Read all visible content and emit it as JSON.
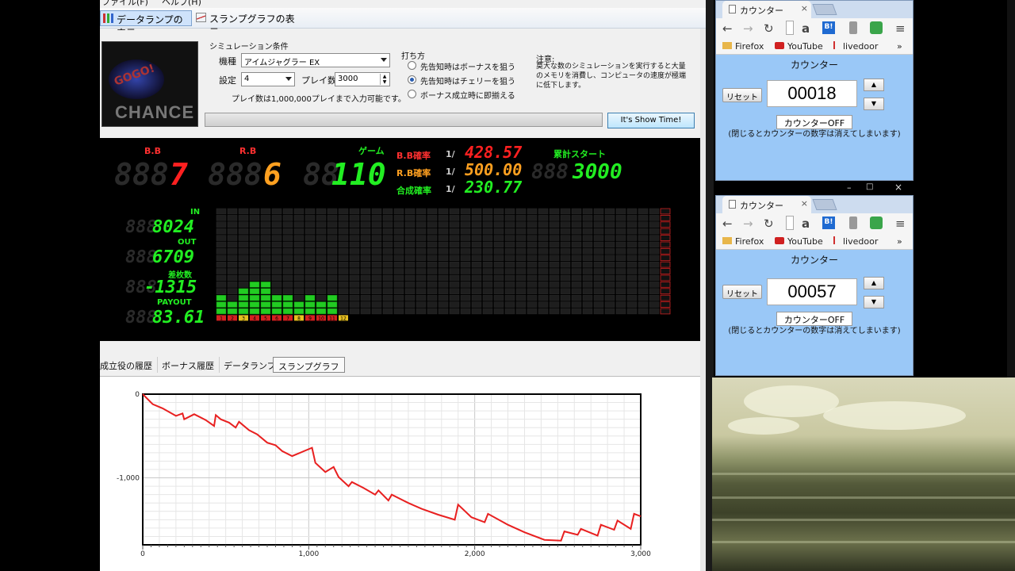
{
  "menu": {
    "file": "ファイル(F)",
    "help": "ヘルプ(H)"
  },
  "toolbar": {
    "data_lamp": "データランプの表示",
    "slump_graph": "スランプグラフの表示"
  },
  "logo": {
    "text1": "GOGO!",
    "text2": "CHANCE"
  },
  "sim": {
    "title": "シミュレーション条件",
    "model_label": "機種",
    "model_value": "アイムジャグラー EX",
    "setting_label": "設定",
    "setting_value": "4",
    "plays_label": "プレイ数",
    "plays_value": "3000",
    "plays_note": "プレイ数は1,000,000プレイまで入力可能です。"
  },
  "strategy": {
    "title": "打ち方",
    "options": [
      "先告知時はボーナスを狙う",
      "先告知時はチェリーを狙う",
      "ボーナス成立時に即揃える"
    ],
    "selected": 1
  },
  "caution": {
    "title": "注意:",
    "text": "莫大な数のシミュレーションを実行すると大量のメモリを消費し、コンピュータの速度が極端に低下します。"
  },
  "run_button": "It's Show Time!",
  "display": {
    "bb_label": "B.B",
    "bb_ghost": "888",
    "bb_value": "7",
    "rb_label": "R.B",
    "rb_ghost": "888",
    "rb_value": "6",
    "game_label": "ゲーム",
    "game_ghost": "88",
    "game_value": "110",
    "bb_rate_label": "B.B確率",
    "bb_rate_prefix": "1/",
    "bb_rate_value": "428.57",
    "rb_rate_label": "R.B確率",
    "rb_rate_prefix": "1/",
    "rb_rate_value": "500.00",
    "total_rate_label": "合成確率",
    "total_rate_prefix": "1/",
    "total_rate_value": "230.77",
    "total_start_label": "累計スタート",
    "total_start_ghost": "888",
    "total_start_value": "3000",
    "in_label": "IN",
    "in_ghost": "888",
    "in_value": "8024",
    "out_label": "OUT",
    "out_ghost": "888",
    "out_value": "6709",
    "diff_label": "差枚数",
    "diff_ghost": "888",
    "diff_value": "-1315",
    "payout_label": "PAYOUT",
    "payout_ghost": "888",
    "payout_value": "83.61",
    "lamp_levels": [
      3,
      2,
      4,
      5,
      5,
      3,
      3,
      2,
      3,
      2,
      3
    ],
    "lamp_labels": [
      "1",
      "2",
      "3",
      "4",
      "5",
      "6",
      "7",
      "8",
      "9",
      "10",
      "11",
      "12"
    ]
  },
  "tabs": [
    "成立役の履歴",
    "ボーナス履歴",
    "データランプ",
    "スランプグラフ"
  ],
  "active_tab": 3,
  "chart_data": {
    "type": "line",
    "title": "",
    "xlabel": "",
    "ylabel": "",
    "xlim": [
      0,
      3000
    ],
    "ylim": [
      -1800,
      0
    ],
    "x_ticks": [
      "0",
      "1,000",
      "2,000",
      "3,000"
    ],
    "y_ticks": [
      "0",
      "-1,000"
    ],
    "series": [
      {
        "x": [
          0,
          60,
          120,
          200,
          240,
          250,
          310,
          380,
          430,
          440,
          470,
          520,
          560,
          580,
          640,
          690,
          750,
          800,
          840,
          900,
          1020,
          1040,
          1100,
          1150,
          1180,
          1240,
          1260,
          1330,
          1400,
          1420,
          1480,
          1500,
          1600,
          1680,
          1780,
          1880,
          1900,
          1980,
          2060,
          2080,
          2200,
          2300,
          2420,
          2520,
          2540,
          2620,
          2640,
          2740,
          2760,
          2840,
          2860,
          2940,
          2960,
          3000
        ],
        "y": [
          0,
          -120,
          -170,
          -260,
          -230,
          -300,
          -240,
          -310,
          -380,
          -250,
          -300,
          -340,
          -400,
          -330,
          -430,
          -480,
          -580,
          -610,
          -680,
          -740,
          -640,
          -820,
          -930,
          -870,
          -990,
          -1100,
          -1050,
          -1120,
          -1200,
          -1150,
          -1270,
          -1200,
          -1300,
          -1370,
          -1440,
          -1500,
          -1320,
          -1470,
          -1530,
          -1430,
          -1560,
          -1650,
          -1740,
          -1750,
          -1640,
          -1680,
          -1610,
          -1690,
          -1560,
          -1620,
          -1510,
          -1610,
          -1430,
          -1460
        ]
      }
    ],
    "grid": true
  },
  "counter1": {
    "tab_title": "カウンター",
    "bookmarks": [
      "Firefox",
      "YouTube",
      "livedoor"
    ],
    "heading": "カウンター",
    "reset": "リセット",
    "value": "00018",
    "off_button": "カウンターOFF",
    "note": "(閉じるとカウンターの数字は消えてしまいます)"
  },
  "counter2": {
    "tab_title": "カウンター",
    "bookmarks": [
      "Firefox",
      "YouTube",
      "livedoor"
    ],
    "heading": "カウンター",
    "reset": "リセット",
    "value": "00057",
    "off_button": "カウンターOFF",
    "note": "(閉じるとカウンターの数字は消えてしまいます)"
  },
  "colors": {
    "red": "#ff2020",
    "orange": "#ffa020",
    "green": "#22ee22",
    "panel_blue": "#9ac8f7",
    "slump_line": "#e82020"
  }
}
